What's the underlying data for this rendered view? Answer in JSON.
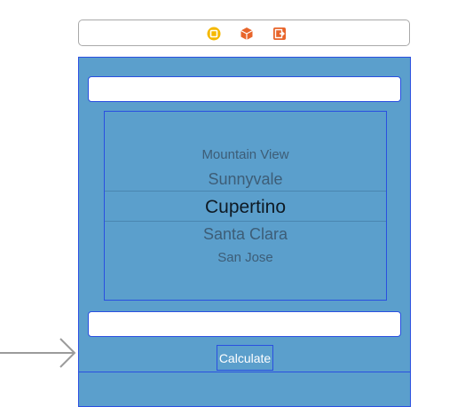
{
  "scene_dock": {
    "icons": [
      "view-controller-icon",
      "first-responder-icon",
      "exit-icon"
    ]
  },
  "picker": {
    "items": [
      "Mountain View",
      "Sunnyvale",
      "Cupertino",
      "Santa Clara",
      "San Jose"
    ],
    "selected": "Cupertino"
  },
  "calculate_button": {
    "label": "Calculate"
  },
  "colors": {
    "view_background": "#5b9fcc",
    "selection_outline": "#2a4fe0",
    "dock_icon_yellow": "#f5b800",
    "dock_icon_orange": "#e8652b"
  }
}
